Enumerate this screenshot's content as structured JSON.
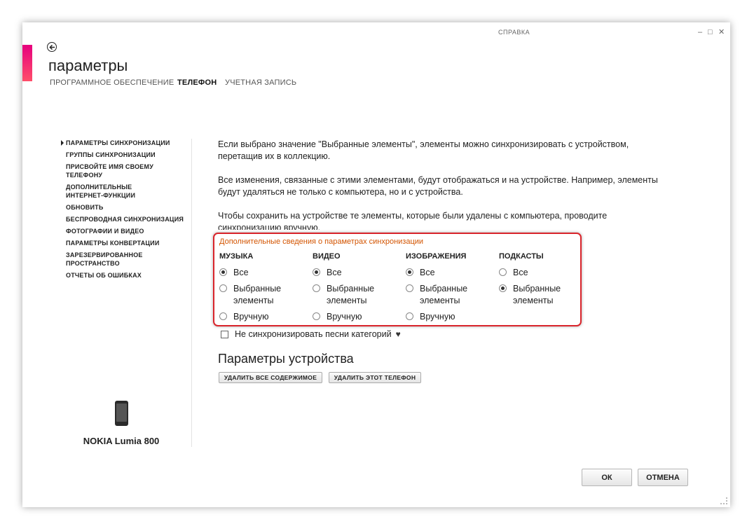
{
  "header": {
    "help": "СПРАВКА",
    "title": "параметры",
    "tabs": [
      {
        "label": "ПРОГРАММНОЕ ОБЕСПЕЧЕНИЕ"
      },
      {
        "label": "ТЕЛЕФОН"
      },
      {
        "label": "УЧЕТНАЯ ЗАПИСЬ"
      }
    ]
  },
  "window_controls": {
    "minimize": "–",
    "maximize": "□",
    "close": "✕"
  },
  "icons": {
    "back": "back-arrow-icon",
    "phone": "phone-icon",
    "heart": "heart-icon"
  },
  "colors": {
    "accent": "#e6007e",
    "link": "#d35400",
    "highlight": "#d9242b"
  },
  "sidebar": {
    "items": [
      {
        "label": "ПАРАМЕТРЫ СИНХРОНИЗАЦИИ"
      },
      {
        "label": "ГРУППЫ СИНХРОНИЗАЦИИ"
      },
      {
        "label": "ПРИСВОЙТЕ ИМЯ СВОЕМУ ТЕЛЕФОНУ"
      },
      {
        "label": "ДОПОЛНИТЕЛЬНЫЕ ИНТЕРНЕТ-ФУНКЦИИ"
      },
      {
        "label": "ОБНОВИТЬ"
      },
      {
        "label": "БЕСПРОВОДНАЯ СИНХРОНИЗАЦИЯ"
      },
      {
        "label": "ФОТОГРАФИИ И ВИДЕО"
      },
      {
        "label": "ПАРАМЕТРЫ КОНВЕРТАЦИИ"
      },
      {
        "label": "ЗАРЕЗЕРВИРОВАННОЕ ПРОСТРАНСТВО"
      },
      {
        "label": "ОТЧЕТЫ ОБ ОШИБКАХ"
      }
    ],
    "device_name": "NOKIA Lumia 800"
  },
  "main": {
    "paragraphs": [
      "Если выбрано значение \"Выбранные элементы\", элементы можно синхронизировать с устройством, перетащив их в коллекцию.",
      "Все изменения, связанные с этими элементами, будут отображаться и на устройстве. Например, элементы будут удаляться не только с компьютера, но и с устройства.",
      "Чтобы сохранить на устройстве те элементы, которые были удалены с компьютера, проводите синхронизацию вручную."
    ],
    "more_info_link": "Дополнительные сведения о параметрах синхронизации",
    "categories": [
      {
        "title": "МУЗЫКА",
        "options": [
          "Все",
          "Выбранные элементы",
          "Вручную"
        ],
        "selected": "Все"
      },
      {
        "title": "ВИДЕО",
        "options": [
          "Все",
          "Выбранные элементы",
          "Вручную"
        ],
        "selected": "Все"
      },
      {
        "title": "ИЗОБРАЖЕНИЯ",
        "options": [
          "Все",
          "Выбранные элементы",
          "Вручную"
        ],
        "selected": "Все"
      },
      {
        "title": "ПОДКАСТЫ",
        "options": [
          "Все",
          "Выбранные элементы"
        ],
        "selected": "Выбранные элементы"
      }
    ],
    "no_sync_checkbox": "Не синхронизировать песни категорий",
    "device_section_title": "Параметры устройства",
    "delete_all_button": "УДАЛИТЬ ВСЕ СОДЕРЖИМОЕ",
    "delete_phone_button": "УДАЛИТЬ ЭТОТ ТЕЛЕФОН"
  },
  "footer": {
    "ok": "ОК",
    "cancel": "ОТМЕНА"
  }
}
